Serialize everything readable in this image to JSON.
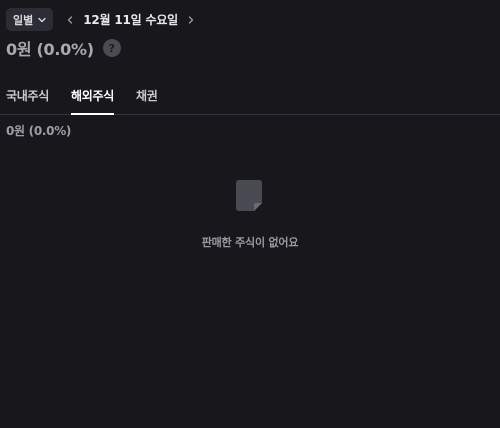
{
  "header": {
    "period_select": {
      "label": "일별",
      "icon": "chevron-down-icon"
    },
    "prev_icon": "chevron-left-icon",
    "next_icon": "chevron-right-icon",
    "date": "12월 11일 수요일"
  },
  "summary": {
    "amount": "0원 (0.0%)",
    "help_symbol": "?"
  },
  "tabs": [
    {
      "label": "국내주식",
      "active": false
    },
    {
      "label": "해외주식",
      "active": true
    },
    {
      "label": "채권",
      "active": false
    }
  ],
  "content": {
    "sub_amount": "0원 (0.0%)",
    "empty_icon": "document-icon",
    "empty_message": "판매한 주식이 없어요"
  },
  "colors": {
    "background": "#17171c",
    "select_bg": "#2c2c35",
    "tab_underline": "#ffffff",
    "muted_text": "#9a9aa2"
  }
}
